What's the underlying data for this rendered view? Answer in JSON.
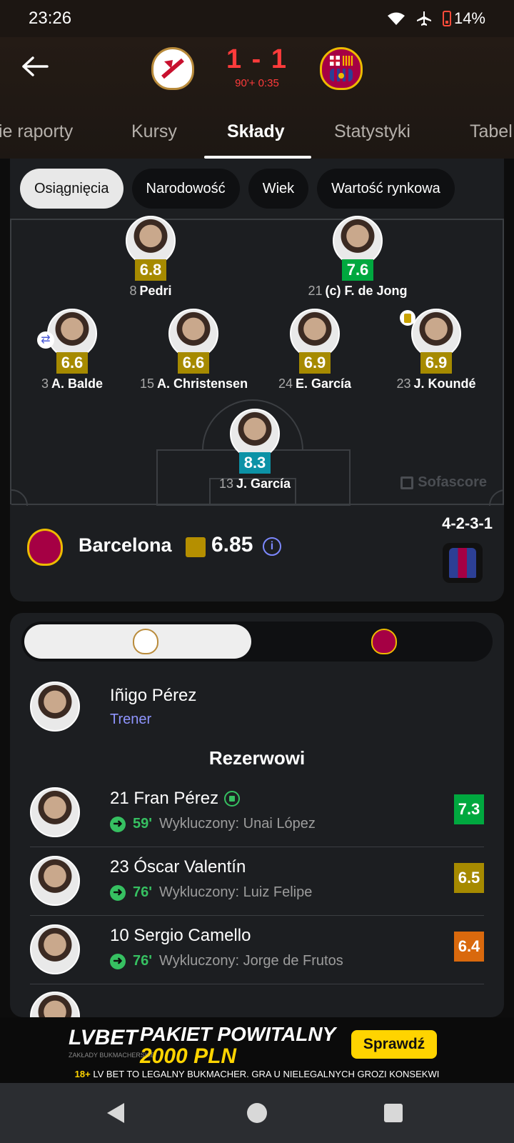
{
  "status_bar": {
    "time": "23:26",
    "battery": "14%"
  },
  "match": {
    "score": "1 - 1",
    "minute": "90'+ 0:35"
  },
  "tabs": [
    {
      "label": "ie raporty"
    },
    {
      "label": "Kursy"
    },
    {
      "label": "Składy"
    },
    {
      "label": "Statystyki"
    },
    {
      "label": "Tabel"
    }
  ],
  "filters": [
    "Osiągnięcia",
    "Narodowość",
    "Wiek",
    "Wartość rynkowa"
  ],
  "lineup": {
    "players": [
      {
        "number": "8",
        "name": "Pedri",
        "rating": "6.8",
        "rating_color": "#a68a00"
      },
      {
        "number": "21",
        "name": "(c) F. de Jong",
        "rating": "7.6",
        "rating_color": "#00a83f"
      },
      {
        "number": "3",
        "name": "A. Balde",
        "rating": "6.6",
        "rating_color": "#a68a00"
      },
      {
        "number": "15",
        "name": "A. Christensen",
        "rating": "6.6",
        "rating_color": "#a68a00"
      },
      {
        "number": "24",
        "name": "E. García",
        "rating": "6.9",
        "rating_color": "#a68a00"
      },
      {
        "number": "23",
        "name": "J. Koundé",
        "rating": "6.9",
        "rating_color": "#a68a00"
      },
      {
        "number": "13",
        "name": "J. García",
        "rating": "8.3",
        "rating_color": "#0c92a6"
      }
    ],
    "watermark": "Sofascore",
    "team": {
      "name": "Barcelona",
      "average_rating": "6.85",
      "formation": "4-2-3-1"
    }
  },
  "coach": {
    "name": "Iñigo Pérez",
    "role": "Trener"
  },
  "substitutes": {
    "title": "Rezerwowi",
    "items": [
      {
        "number_name": "21 Fran Pérez",
        "minute": "59'",
        "detail": "Wykluczony: Unai López",
        "rating": "7.3",
        "rating_color": "#00a83f",
        "goal": true
      },
      {
        "number_name": "23 Óscar Valentín",
        "minute": "76'",
        "detail": "Wykluczony: Luiz Felipe",
        "rating": "6.5",
        "rating_color": "#a68a00",
        "goal": false
      },
      {
        "number_name": "10 Sergio Camello",
        "minute": "76'",
        "detail": "Wykluczony: Jorge de Frutos",
        "rating": "6.4",
        "rating_color": "#d9690d",
        "goal": false
      }
    ]
  },
  "ad": {
    "logo": "LVBET",
    "logo_sub": "ZAKŁADY BUKMACHERSKIE",
    "headline": "PAKIET POWITALNY",
    "amount": "2000 PLN",
    "button": "Sprawdź",
    "age": "18+",
    "disclaimer": "LV BET TO LEGALNY BUKMACHER. GRA U NIELEGALNYCH GROZI KONSEKWI"
  }
}
